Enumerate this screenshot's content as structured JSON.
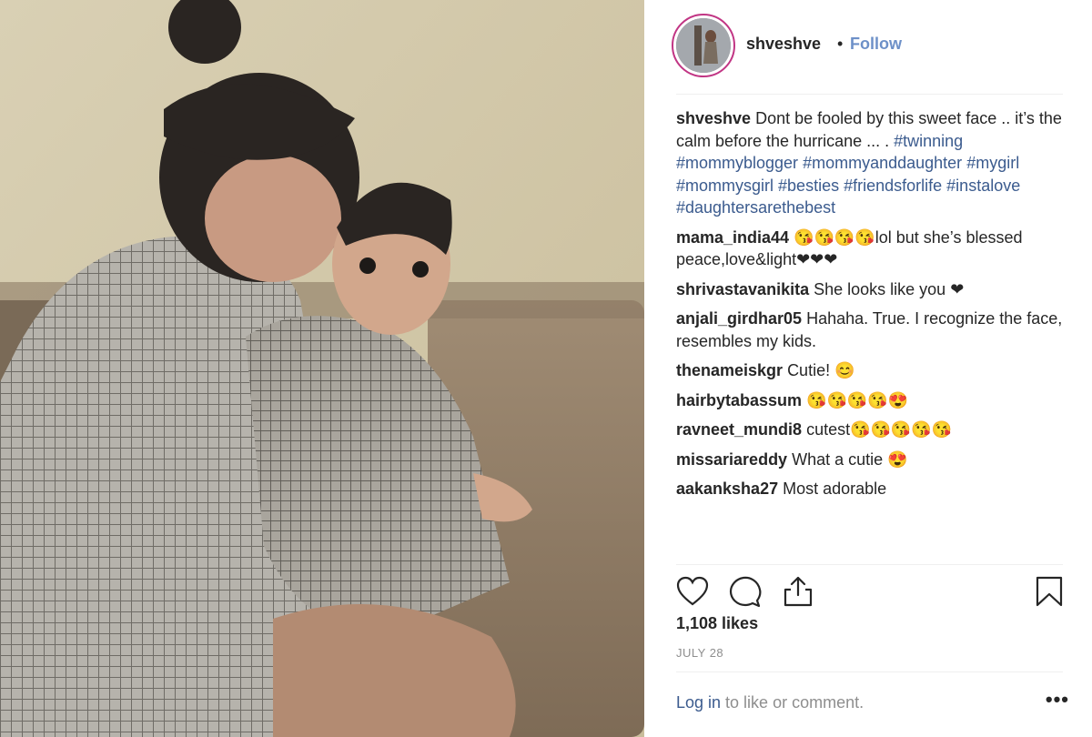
{
  "post": {
    "username": "shveshve",
    "separator": "•",
    "follow_label": "Follow",
    "photo_desc": "photo",
    "caption": {
      "user": "shveshve",
      "text": "Dont be fooled by this sweet face .. it’s the calm before the hurricane ... .",
      "hashtags": [
        "#twinning",
        "#mommyblogger",
        "#mommyanddaughter",
        "#mygirl",
        "#mommysgirl",
        "#besties",
        "#friendsforlife",
        "#instalove",
        "#daughtersarethebest"
      ]
    },
    "comments": [
      {
        "user": "mama_india44",
        "text": "😘😘😘😘lol but she’s blessed peace,love&light❤❤❤"
      },
      {
        "user": "shrivastavanikita",
        "text": "She looks like you ❤"
      },
      {
        "user": "anjali_girdhar05",
        "text": "Hahaha. True. I recognize the face, resembles my kids."
      },
      {
        "user": "thenameiskgr",
        "text": "Cutie! 😊"
      },
      {
        "user": "hairbytabassum",
        "text": "😘😘😘😘😍"
      },
      {
        "user": "ravneet_mundi8",
        "text": "cutest😘😘😘😘😘"
      },
      {
        "user": "missariareddy",
        "text": "What a cutie 😍"
      },
      {
        "user": "aakanksha27",
        "text": "Most adorable"
      }
    ],
    "likes": "1,108 likes",
    "date": "JULY 28",
    "login_link": "Log in",
    "login_rest": " to like or comment.",
    "more_label": "•••",
    "icons": {
      "like": "heart-icon",
      "comment": "comment-icon",
      "share": "share-icon",
      "save": "bookmark-icon"
    },
    "colors": {
      "link": "#3b5b8e",
      "follow": "#6d90c8",
      "ring": "#c13584",
      "muted": "#8e8e8e"
    }
  }
}
